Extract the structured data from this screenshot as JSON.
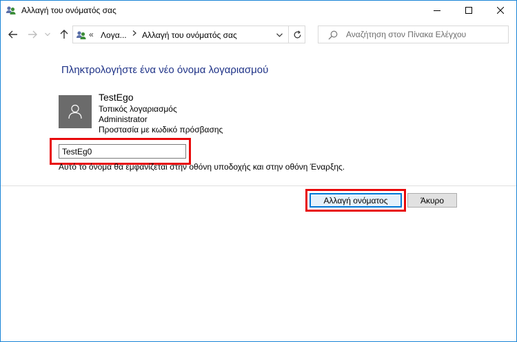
{
  "window": {
    "title": "Αλλαγή του ονόματός σας",
    "icon": "user-accounts-icon"
  },
  "nav": {
    "breadcrumb_overflow": "«",
    "breadcrumb_parent": "Λογα...",
    "breadcrumb_current": "Αλλαγή του ονόματός σας"
  },
  "search": {
    "placeholder": "Αναζήτηση στον Πίνακα Ελέγχου"
  },
  "main": {
    "heading": "Πληκτρολογήστε ένα νέο όνομα λογαριασμού",
    "account": {
      "name": "TestEgo",
      "type": "Τοπικός λογαριασμός",
      "role": "Administrator",
      "protection": "Προστασία με κωδικό πρόσβασης"
    },
    "new_name_value": "TestEg0",
    "hint": "Αυτό το όνομα θα εμφανίζεται στην οθόνη υποδοχής και στην οθόνη Έναρξης."
  },
  "buttons": {
    "change_name": "Αλλαγή ονόματος",
    "cancel": "Άκυρο"
  },
  "colors": {
    "heading": "#1e3287",
    "highlight": "#e8090b",
    "accent": "#0078d7"
  }
}
